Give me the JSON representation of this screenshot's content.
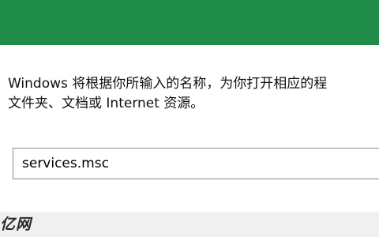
{
  "dialog": {
    "description_lines": [
      "Windows 将根据你所输入的名称，为你打开相应的程",
      "文件夹、文档或 Internet 资源。"
    ],
    "open_input_value": "services.msc",
    "watermark": "亿网"
  },
  "colors": {
    "titlebar": "#1f8d47",
    "background": "#ffffff",
    "input_border": "#8c8c8c",
    "bottom_strip": "#f0f0f0"
  }
}
